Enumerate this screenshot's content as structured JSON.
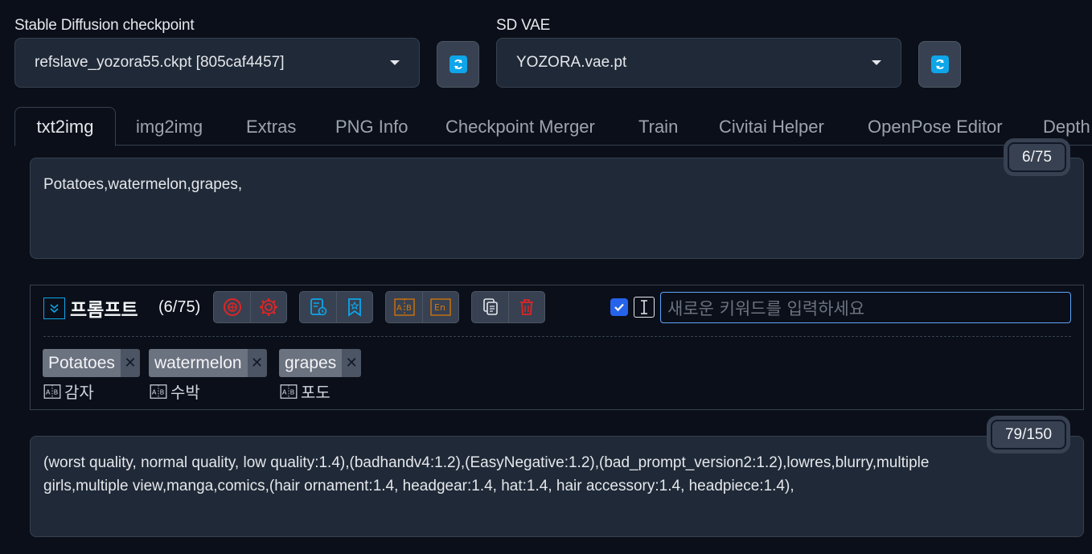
{
  "checkpoint": {
    "label": "Stable Diffusion checkpoint",
    "value": "refslave_yozora55.ckpt [805caf4457]"
  },
  "vae": {
    "label": "SD VAE",
    "value": "YOZORA.vae.pt"
  },
  "tabs": [
    {
      "label": "txt2img",
      "active": true
    },
    {
      "label": "img2img"
    },
    {
      "label": "Extras"
    },
    {
      "label": "PNG Info"
    },
    {
      "label": "Checkpoint Merger"
    },
    {
      "label": "Train"
    },
    {
      "label": "Civitai Helper"
    },
    {
      "label": "OpenPose Editor"
    },
    {
      "label": "Depth"
    }
  ],
  "prompt": {
    "text": "Potatoes,watermelon,grapes,",
    "token_count": "6/75"
  },
  "prompt_panel": {
    "title": "프롬프트",
    "count": "(6/75)",
    "keyword_placeholder": "새로운 키워드를 입력하세요",
    "auto_checked": true,
    "tags": [
      {
        "text": "Potatoes",
        "translation": "감자"
      },
      {
        "text": "watermelon",
        "translation": "수박"
      },
      {
        "text": "grapes",
        "translation": "포도"
      }
    ]
  },
  "negative_prompt": {
    "text": "(worst quality, normal quality, low quality:1.4),(badhandv4:1.2),(EasyNegative:1.2),(bad_prompt_version2:1.2),lowres,blurry,multiple girls,multiple view,manga,comics,(hair ornament:1.4, headgear:1.4, hat:1.4, hair accessory:1.4, headpiece:1.4),",
    "token_count": "79/150"
  },
  "colors": {
    "background": "#0b0f19",
    "panel": "#1f2937",
    "border": "#374151",
    "accent_blue": "#0ea5e9",
    "red_icon": "#dc2626",
    "orange_icon": "#d97706",
    "checkbox": "#2563eb"
  }
}
